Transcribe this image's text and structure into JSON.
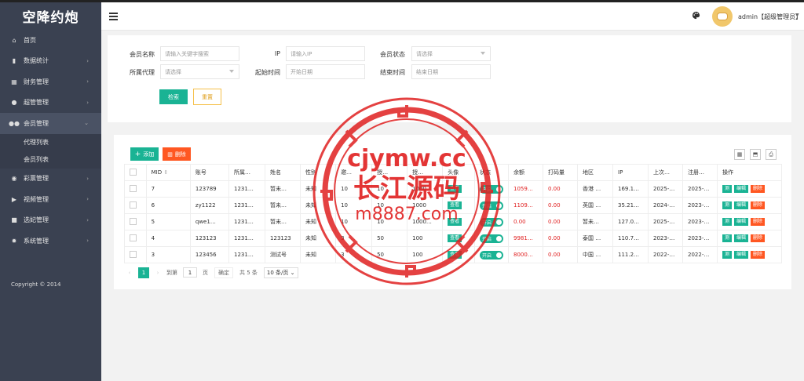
{
  "app": {
    "brand": "空降约炮"
  },
  "sidebar": {
    "items": [
      {
        "label": "首页",
        "icon": "home-icon"
      },
      {
        "label": "数据统计",
        "icon": "bar-chart-icon"
      },
      {
        "label": "财务管理",
        "icon": "bank-icon"
      },
      {
        "label": "超管管理",
        "icon": "user-icon"
      },
      {
        "label": "会员管理",
        "icon": "users-icon"
      },
      {
        "label": "彩票管理",
        "icon": "gamepad-icon"
      },
      {
        "label": "视频管理",
        "icon": "video-icon"
      },
      {
        "label": "选妃管理",
        "icon": "camera-icon"
      },
      {
        "label": "系统管理",
        "icon": "gear-icon"
      }
    ],
    "sub_items": [
      {
        "label": "代理列表"
      },
      {
        "label": "会员列表"
      }
    ],
    "copyright": "Copyright © 2014"
  },
  "header": {
    "user": "admin【超级管理员】"
  },
  "search": {
    "member_name_label": "会员名称",
    "member_name_placeholder": "请输入关键字搜索",
    "ip_label": "IP",
    "ip_placeholder": "请输入IP",
    "status_label": "会员状态",
    "status_value": "请选择",
    "agent_label": "所属代理",
    "agent_value": "请选择",
    "start_label": "起始时间",
    "start_placeholder": "开始日期",
    "end_label": "结束时间",
    "end_placeholder": "结束日期",
    "search_btn": "检索",
    "reset_btn": "重置"
  },
  "toolbar": {
    "add_label": "添加",
    "delete_label": "删除"
  },
  "table": {
    "columns": [
      "MID",
      "账号",
      "所属…",
      "姓名",
      "性别",
      "邀…",
      "授…",
      "授…",
      "头像",
      "状态",
      "余额",
      "打码量",
      "地区",
      "IP",
      "上次…",
      "注册…",
      "操作"
    ],
    "rows": [
      {
        "mid": "7",
        "account": "123789",
        "agent": "1231…",
        "name": "暂未…",
        "gender": "未知",
        "c6": "10",
        "c7": "10",
        "c8": "1000",
        "avatar_btn": "查看",
        "status": "开启",
        "balance": "1059…",
        "bet": "0.00",
        "region": "香港 …",
        "ip": "169.1…",
        "last": "2025-…",
        "reg": "2025-…"
      },
      {
        "mid": "6",
        "account": "zy1122",
        "agent": "1231…",
        "name": "暂未…",
        "gender": "未知",
        "c6": "10",
        "c7": "10",
        "c8": "1000",
        "avatar_btn": "查看",
        "status": "开启",
        "balance": "1109…",
        "bet": "0.00",
        "region": "英国 …",
        "ip": "35.21…",
        "last": "2024-…",
        "reg": "2023-…"
      },
      {
        "mid": "5",
        "account": "qwe1…",
        "agent": "1231…",
        "name": "暂未…",
        "gender": "未知",
        "c6": "10",
        "c7": "10",
        "c8": "1000…",
        "avatar_btn": "查看",
        "status": "开启",
        "balance": "0.00",
        "bet": "0.00",
        "region": "暂未…",
        "ip": "127.0…",
        "last": "2025-…",
        "reg": "2023-…"
      },
      {
        "mid": "4",
        "account": "123123",
        "agent": "1231…",
        "name": "123123",
        "gender": "未知",
        "c6": "3",
        "c7": "50",
        "c8": "100",
        "avatar_btn": "查看",
        "status": "开启",
        "balance": "9981…",
        "bet": "0.00",
        "region": "泰国 …",
        "ip": "110.7…",
        "last": "2023-…",
        "reg": "2023-…"
      },
      {
        "mid": "3",
        "account": "123456",
        "agent": "1231…",
        "name": "测试号",
        "gender": "未知",
        "c6": "3",
        "c7": "50",
        "c8": "100",
        "avatar_btn": "查看",
        "status": "开启",
        "balance": "8000…",
        "bet": "0.00",
        "region": "中国 …",
        "ip": "111.2…",
        "last": "2022-…",
        "reg": "2022-…"
      }
    ],
    "actions": [
      "测",
      "编辑",
      "删除"
    ]
  },
  "pager": {
    "current": "1",
    "goto_label": "到第",
    "goto_value": "1",
    "page_unit": "页",
    "confirm": "确定",
    "total": "共 5 条",
    "per_page": "10 条/页"
  },
  "watermark": {
    "line1": "cjymw.cc",
    "line2": "长江源码",
    "line3": "m8887.com"
  },
  "colors": {
    "sidebar": "#3a4151",
    "accent": "#1ab394",
    "danger": "#ff5722",
    "warning": "#f5c04a",
    "watermark": "#e02020"
  }
}
